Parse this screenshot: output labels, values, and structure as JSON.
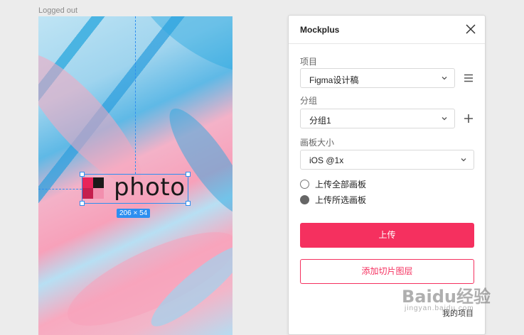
{
  "canvas": {
    "frame_label": "Logged out",
    "logo_text": "photo",
    "size_tag": "206 × 54"
  },
  "panel": {
    "title": "Mockplus",
    "project": {
      "label": "项目",
      "value": "Figma设计稿"
    },
    "group": {
      "label": "分组",
      "value": "分组1"
    },
    "board_size": {
      "label": "画板大小",
      "value": "iOS @1x"
    },
    "upload_options": [
      {
        "label": "上传全部画板",
        "checked": false
      },
      {
        "label": "上传所选画板",
        "checked": true
      }
    ],
    "upload_button": "上传",
    "add_slice_button": "添加切片图层",
    "my_projects_link": "我的项目"
  },
  "watermark": {
    "main": "Baidu经验",
    "sub": "jingyan.baidu.com"
  },
  "colors": {
    "accent": "#f5305f",
    "selection": "#2d8ff0"
  },
  "icons": {
    "close": "close-icon",
    "menu": "list-menu-icon",
    "add": "plus-icon",
    "dropdown": "chevron-down-icon"
  }
}
